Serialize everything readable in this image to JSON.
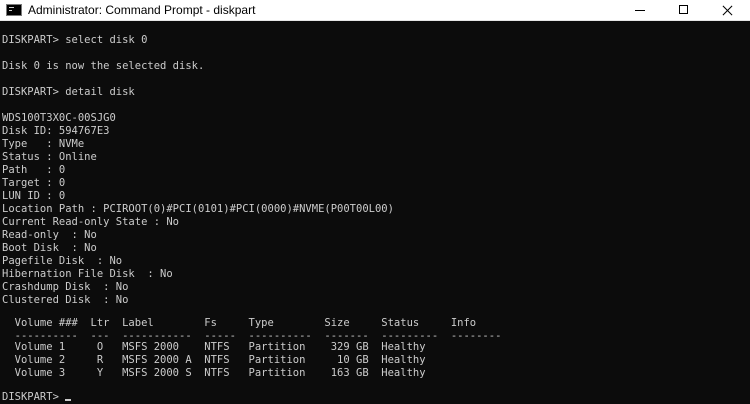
{
  "window": {
    "title": "Administrator: Command Prompt - diskpart",
    "icon": "cmd-icon"
  },
  "console": {
    "lines": [
      "",
      "DISKPART> select disk 0",
      "",
      "Disk 0 is now the selected disk.",
      "",
      "DISKPART> detail disk",
      "",
      "WDS100T3X0C-00SJG0",
      "Disk ID: 594767E3",
      "Type   : NVMe",
      "Status : Online",
      "Path   : 0",
      "Target : 0",
      "LUN ID : 0",
      "Location Path : PCIROOT(0)#PCI(0101)#PCI(0000)#NVME(P00T00L00)",
      "Current Read-only State : No",
      "Read-only  : No",
      "Boot Disk  : No",
      "Pagefile Disk  : No",
      "Hibernation File Disk  : No",
      "Crashdump Disk  : No",
      "Clustered Disk  : No",
      "",
      "  Volume ###  Ltr  Label        Fs     Type        Size     Status     Info",
      "  ----------  ---  -----------  -----  ----------  -------  ---------  --------",
      "  Volume 1     O   MSFS 2000    NTFS   Partition    329 GB  Healthy",
      "  Volume 2     R   MSFS 2000 A  NTFS   Partition     10 GB  Healthy",
      "  Volume 3     Y   MSFS 2000 S  NTFS   Partition    163 GB  Healthy",
      "",
      "DISKPART> "
    ]
  }
}
